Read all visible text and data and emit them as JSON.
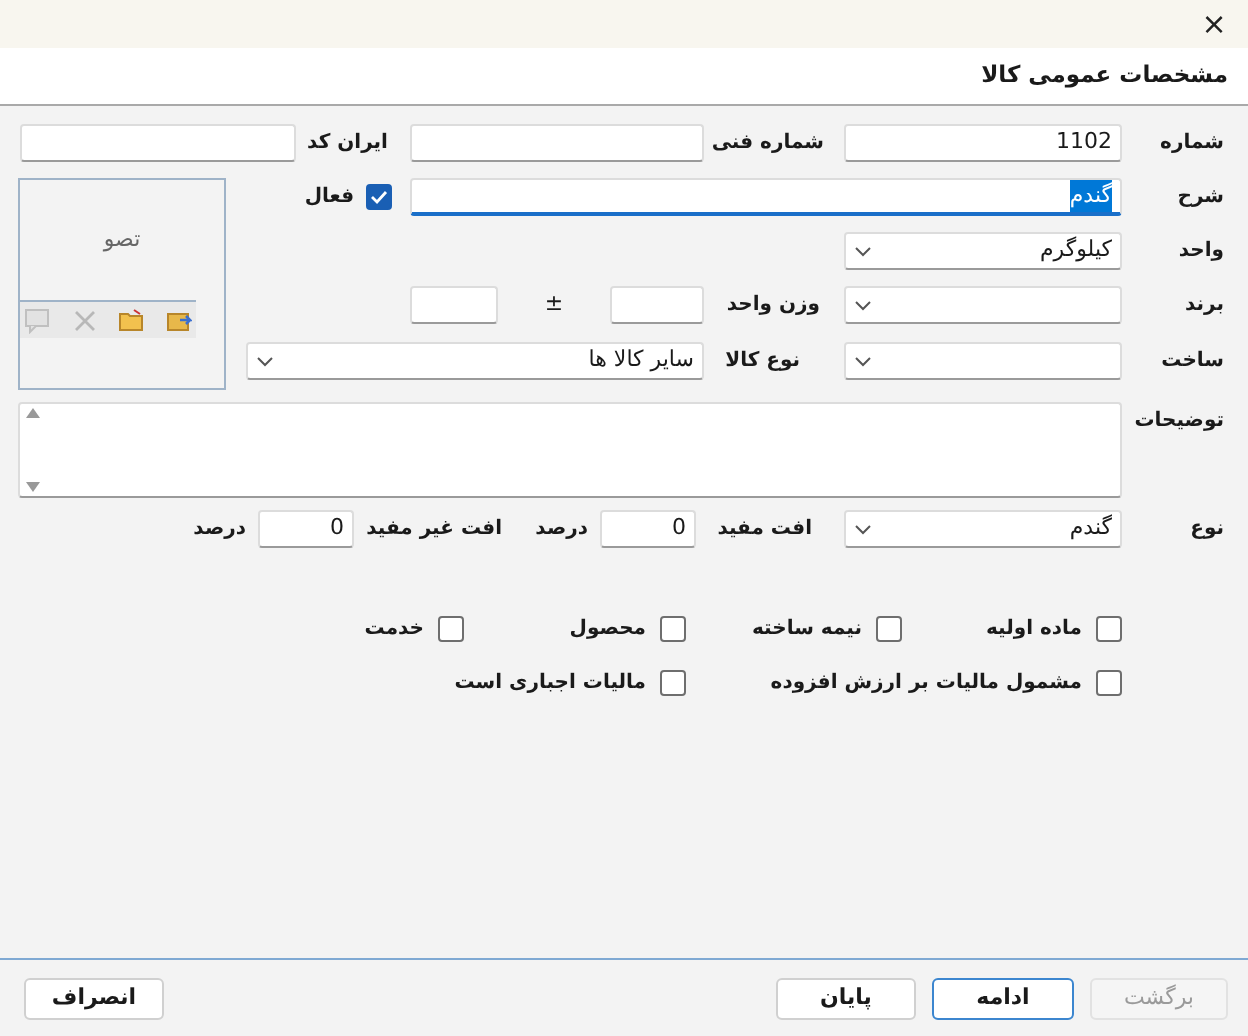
{
  "window": {
    "close": "×"
  },
  "header": {
    "title": "مشخصات عمومی کالا"
  },
  "row1": [
    {
      "label": "شماره",
      "value": "1102"
    },
    {
      "label": "شماره فنی"
    },
    {
      "label": "ایران کد"
    }
  ],
  "description": {
    "label": "شرح",
    "value": "گندم",
    "selected": true,
    "focused": true
  },
  "active": {
    "label": "فعال",
    "checked": true
  },
  "image_panel": {
    "text": "تصو",
    "tools": [
      {
        "kind": "load",
        "disabled": false
      },
      {
        "kind": "open",
        "disabled": false
      },
      {
        "kind": "delete",
        "disabled": true
      },
      {
        "kind": "comment",
        "disabled": true
      }
    ]
  },
  "unit": {
    "label": "واحد",
    "value": "کیلوگرم"
  },
  "brand": {
    "label": "برند"
  },
  "unit_weight": {
    "label": "وزن واحد",
    "tolerance": "±"
  },
  "make": {
    "label": "ساخت"
  },
  "goods_type": {
    "label": "نوع کالا",
    "value": "سایر کالا ها"
  },
  "notes": {
    "label": "توضیحات"
  },
  "kind": {
    "label": "نوع",
    "value": "گندم"
  },
  "waste": [
    {
      "label": "افت مفید",
      "value": "0",
      "unit": "درصد"
    },
    {
      "label": "افت غیر مفید",
      "value": "0",
      "unit": "درصد"
    }
  ],
  "checkboxes": [
    [
      {
        "label": "ماده اولیه",
        "checked": false
      },
      {
        "label": "نیمه ساخته",
        "checked": false
      },
      {
        "label": "محصول",
        "checked": false
      },
      {
        "label": "خدمت",
        "checked": false
      }
    ],
    [
      {
        "label": "مشمول مالیات بر ارزش افزوده",
        "checked": false
      },
      {
        "label": "مالیات اجباری است",
        "checked": false
      }
    ]
  ],
  "buttons": [
    {
      "label": "برگشت",
      "disabled": true,
      "default": false
    },
    {
      "label": "ادامه",
      "disabled": false,
      "default": true
    },
    {
      "label": "پایان",
      "disabled": false,
      "default": false
    },
    {
      "label": "انصراف",
      "disabled": false,
      "default": false
    }
  ]
}
